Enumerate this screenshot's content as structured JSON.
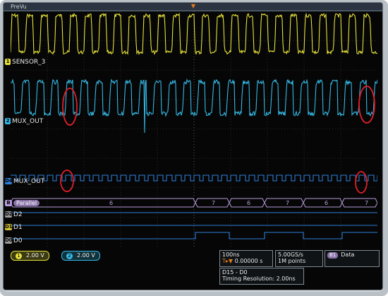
{
  "window": {
    "title": "PreVu"
  },
  "colors": {
    "ch1": "#e6e23a",
    "ch2": "#35b9e6",
    "digital": "#2f7fd6",
    "bus": "#b59ad8",
    "highlight": "#e0202a"
  },
  "channels": [
    {
      "number": "1",
      "label": "SENSOR_3"
    },
    {
      "number": "2",
      "label": "MUX_OUT"
    }
  ],
  "digital_channels": [
    {
      "number": "D4",
      "label": "MUX_OUT"
    },
    {
      "number": "D2",
      "label": "D2"
    },
    {
      "number": "D1",
      "label": "D1"
    },
    {
      "number": "D0",
      "label": "D0"
    }
  ],
  "bus": {
    "label": "Parallel",
    "values": [
      "6",
      "7",
      "6",
      "7",
      "6",
      "7"
    ]
  },
  "readouts": {
    "ch1_scale": "2.00 V",
    "ch2_scale": "2.00 V",
    "timebase": "100ns",
    "trigger_offset": "0.00000 s",
    "sample_rate": "5.00GS/s",
    "record_length": "1M points",
    "data_label": "Data",
    "bits": "D15 - D0",
    "timing_resolution": "Timing Resolution: 2.00ns"
  }
}
